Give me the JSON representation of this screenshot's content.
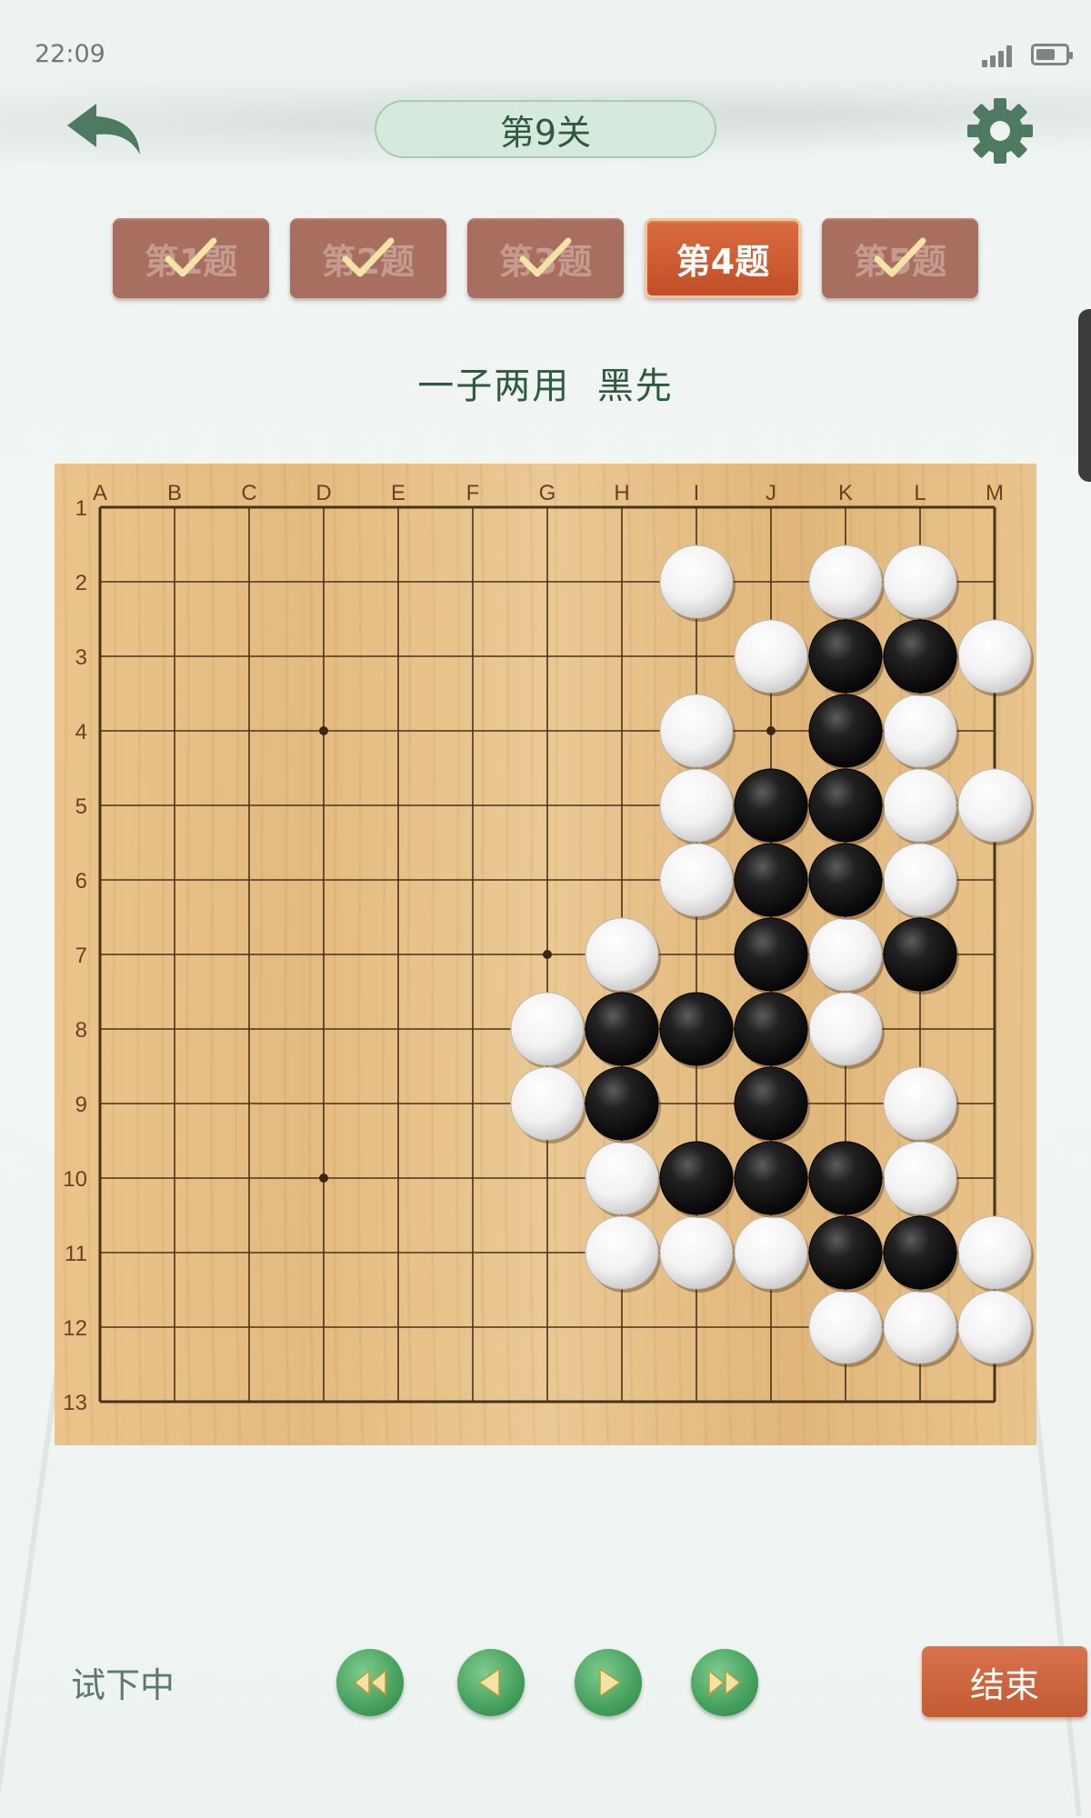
{
  "status_bar": {
    "time": "22:09"
  },
  "header": {
    "level_title": "第9关",
    "back_icon": "undo-arrow-icon",
    "settings_icon": "gear-icon"
  },
  "tabs": [
    {
      "label": "第1题",
      "completed": true
    },
    {
      "label": "第2题",
      "completed": true
    },
    {
      "label": "第3题",
      "completed": true
    },
    {
      "label": "第4题",
      "completed": false,
      "active": true
    },
    {
      "label": "第5题",
      "completed": true
    }
  ],
  "puzzle": {
    "title": "一子两用  黑先"
  },
  "board": {
    "size": 13,
    "columns": [
      "A",
      "B",
      "C",
      "D",
      "E",
      "F",
      "G",
      "H",
      "I",
      "J",
      "K",
      "L",
      "M"
    ],
    "rows": [
      "1",
      "2",
      "3",
      "4",
      "5",
      "6",
      "7",
      "8",
      "9",
      "10",
      "11",
      "12",
      "13"
    ],
    "star_points": [
      "D4",
      "J4",
      "G7",
      "D10"
    ],
    "black_stones": [
      "K3",
      "L3",
      "K4",
      "J5",
      "K5",
      "J6",
      "K6",
      "J7",
      "L7",
      "H8",
      "I8",
      "J8",
      "H9",
      "J9",
      "I10",
      "J10",
      "K10",
      "K11",
      "L11"
    ],
    "white_stones": [
      "I2",
      "K2",
      "L2",
      "J3",
      "M3",
      "I4",
      "L4",
      "I5",
      "L5",
      "M5",
      "I6",
      "L6",
      "H7",
      "K7",
      "G8",
      "K8",
      "G9",
      "L9",
      "H10",
      "L10",
      "H11",
      "I11",
      "J11",
      "M11",
      "K12",
      "L12",
      "M12"
    ]
  },
  "controls": {
    "status_text": "试下中",
    "first_icon": "rewind-icon",
    "prev_icon": "play-left-icon",
    "next_icon": "play-right-icon",
    "last_icon": "fast-forward-icon",
    "end_label": "结束"
  },
  "colors": {
    "accent": "#c25a33",
    "tab_done": "#a86e60",
    "nav_green": "#45a05c",
    "board": "#e8c48c"
  }
}
